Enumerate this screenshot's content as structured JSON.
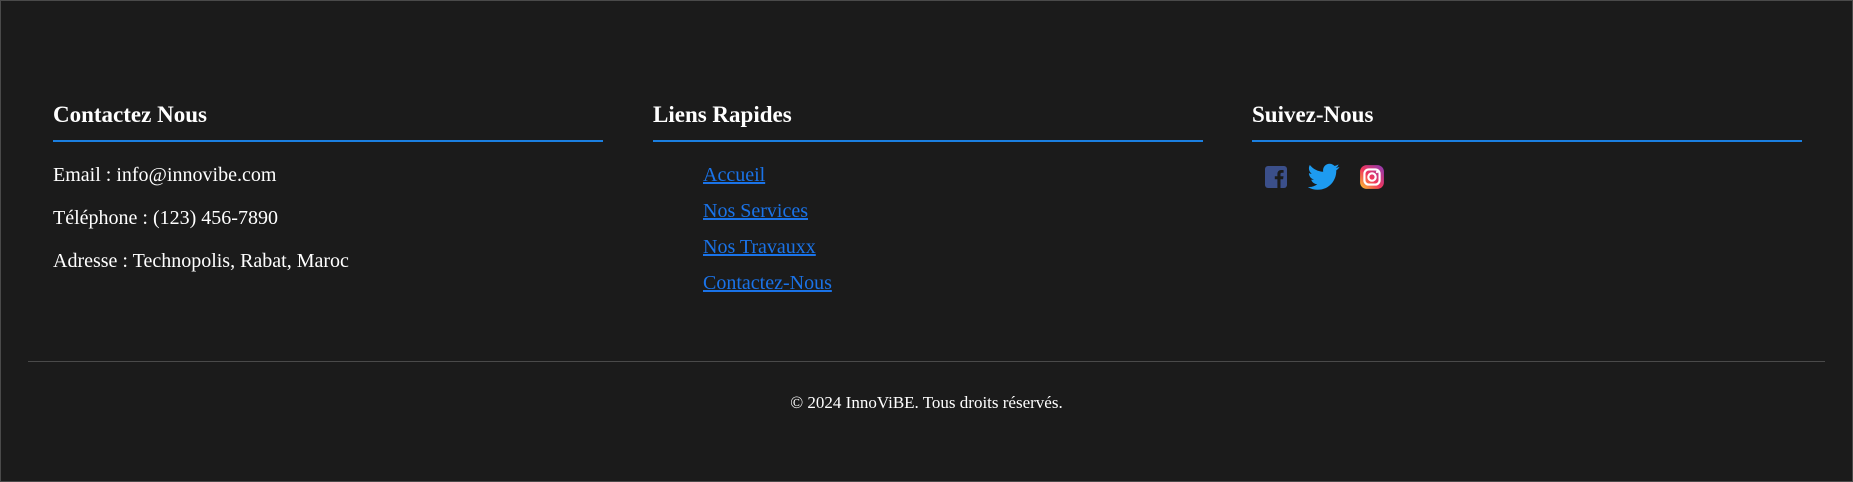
{
  "contact": {
    "heading": "Contactez Nous",
    "email": "Email : info@innovibe.com",
    "phone": "Téléphone : (123) 456-7890",
    "address": "Adresse : Technopolis, Rabat, Maroc"
  },
  "quick_links": {
    "heading": "Liens Rapides",
    "items": [
      {
        "label": "Accueil"
      },
      {
        "label": "Nos Services"
      },
      {
        "label": "Nos Travauxx"
      },
      {
        "label": "Contactez-Nous"
      }
    ]
  },
  "social": {
    "heading": "Suivez-Nous",
    "icons": [
      "facebook-icon",
      "twitter-icon",
      "instagram-icon"
    ]
  },
  "footer": {
    "copyright": "© 2024 InnoViBE. Tous droits réservés."
  },
  "colors": {
    "background": "#1b1b1b",
    "accent": "#1b7fe0",
    "link": "#1a73e8",
    "text": "#ffffff"
  }
}
